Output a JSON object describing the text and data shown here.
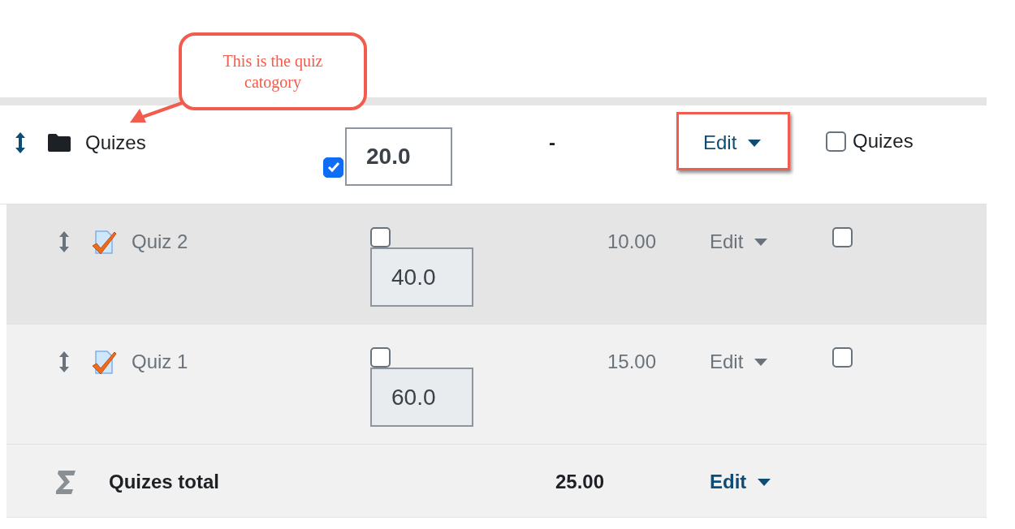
{
  "annotations": [
    {
      "kind": "callout",
      "text": "This is the quiz catogory"
    },
    {
      "kind": "highlight"
    }
  ],
  "rows": [
    {
      "kind": "category",
      "name": "Quizes",
      "dimmed": false,
      "weight_checked": true,
      "weight": "20.0",
      "max": "-",
      "edit": "Edit",
      "select_checked": false,
      "select_label": "Quizes"
    },
    {
      "kind": "item",
      "name": "Quiz 2",
      "dimmed": true,
      "weight_checked": false,
      "weight": "40.0",
      "max": "10.00",
      "edit": "Edit",
      "select_checked": false
    },
    {
      "kind": "item",
      "name": "Quiz 1",
      "dimmed": true,
      "weight_checked": false,
      "weight": "60.0",
      "max": "15.00",
      "edit": "Edit",
      "select_checked": false
    },
    {
      "kind": "total",
      "name": "Quizes total",
      "dimmed": false,
      "max": "25.00",
      "edit": "Edit"
    }
  ]
}
